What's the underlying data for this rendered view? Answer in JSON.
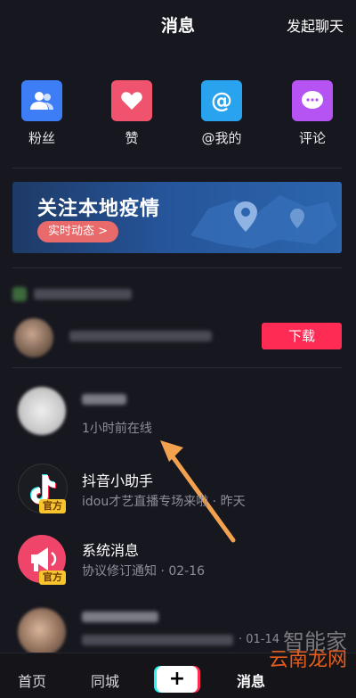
{
  "header": {
    "title": "消息",
    "start_chat_label": "发起聊天"
  },
  "quick_actions": [
    {
      "label": "粉丝",
      "icon": "fans-icon",
      "color": "#3d7df5"
    },
    {
      "label": "赞",
      "icon": "heart-icon",
      "color": "#f0536e"
    },
    {
      "label": "@我的",
      "icon": "at-icon",
      "color": "#2aa3ee"
    },
    {
      "label": "评论",
      "icon": "comment-icon",
      "color": "#b553f3"
    }
  ],
  "banner": {
    "title": "关注本地疫情",
    "button_label": "实时动态 >"
  },
  "suggestion": {
    "download_label": "下载"
  },
  "messages": [
    {
      "name": "",
      "subtitle": "1小时前在线"
    },
    {
      "name": "抖音小助手",
      "subtitle": "idou才艺直播专场来啦 · 昨天",
      "badge": "官方"
    },
    {
      "name": "系统消息",
      "subtitle": "协议修订通知 · 02-16",
      "badge": "官方"
    },
    {
      "name": "",
      "subtitle": "· 01-14"
    }
  ],
  "tabbar": {
    "home": "首页",
    "city": "同城",
    "plus": "+",
    "messages": "消息"
  },
  "watermark": "云南龙网",
  "watermark_back": "智能家"
}
